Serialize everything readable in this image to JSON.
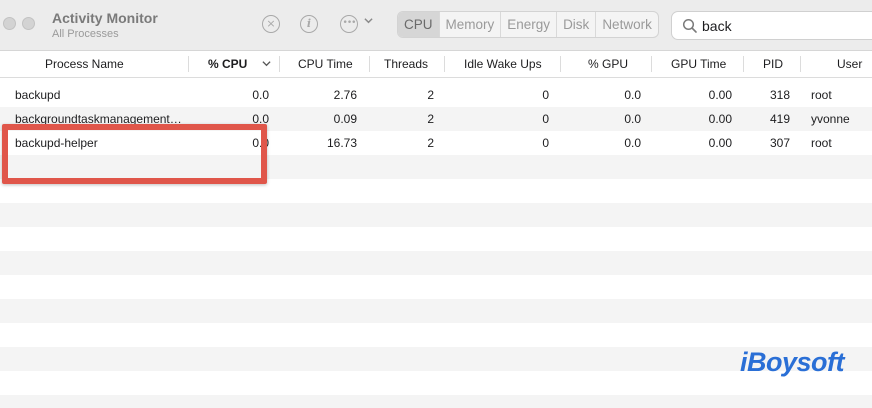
{
  "window": {
    "title": "Activity Monitor",
    "subtitle": "All Processes"
  },
  "toolbar": {
    "stop_icon": "stop-process-icon",
    "info_icon": "info-icon",
    "more_icon": "ellipsis-icon",
    "info_glyph": "i",
    "more_glyph": "•••",
    "tabs": [
      {
        "label": "CPU",
        "active": true
      },
      {
        "label": "Memory",
        "active": false
      },
      {
        "label": "Energy",
        "active": false
      },
      {
        "label": "Disk",
        "active": false
      },
      {
        "label": "Network",
        "active": false
      }
    ],
    "search": {
      "value": "back",
      "placeholder": "Search"
    }
  },
  "table": {
    "columns": [
      "Process Name",
      "% CPU",
      "CPU Time",
      "Threads",
      "Idle Wake Ups",
      "% GPU",
      "GPU Time",
      "PID",
      "User"
    ],
    "sort_column": "% CPU",
    "rows": [
      {
        "name": "backupd",
        "cpu": "0.0",
        "cpu_time": "2.76",
        "threads": "2",
        "idle_wake_ups": "0",
        "gpu": "0.0",
        "gpu_time": "0.00",
        "pid": "318",
        "user": "root"
      },
      {
        "name": "backgroundtaskmanagement…",
        "cpu": "0.0",
        "cpu_time": "0.09",
        "threads": "2",
        "idle_wake_ups": "0",
        "gpu": "0.0",
        "gpu_time": "0.00",
        "pid": "419",
        "user": "yvonne"
      },
      {
        "name": "backupd-helper",
        "cpu": "0.0",
        "cpu_time": "16.73",
        "threads": "2",
        "idle_wake_ups": "0",
        "gpu": "0.0",
        "gpu_time": "0.00",
        "pid": "307",
        "user": "root"
      }
    ]
  },
  "annotation": {
    "highlight_color": "#e0564a",
    "highlighted_row": "backupd-helper"
  },
  "watermark": {
    "text": "iBoysoft",
    "color": "#2a6fd6"
  }
}
